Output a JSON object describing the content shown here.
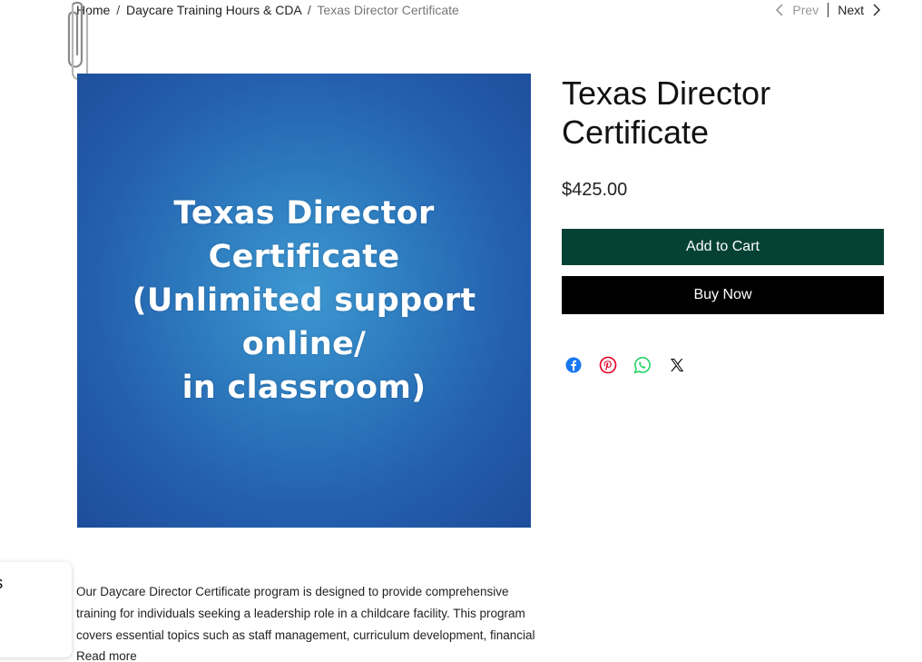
{
  "breadcrumb": {
    "home": "Home",
    "separator": "/",
    "category": "Daycare Training Hours & CDA",
    "current": "Texas Director Certificate"
  },
  "pager": {
    "prev_label": "Prev",
    "next_label": "Next"
  },
  "product": {
    "image_text": {
      "line1": "Texas Director",
      "line2": "Certificate",
      "line3": "(Unlimited support",
      "line4": "online/",
      "line5": "in classroom)"
    },
    "title": "Texas Director Certificate",
    "price": "$425.00",
    "add_to_cart_label": "Add to Cart",
    "buy_now_label": "Buy Now",
    "description": "Our Daycare Director Certificate program is designed to provide comprehensive training for individuals seeking a leadership role in a childcare facility. This program covers essential topics such as staff management, curriculum development, financial",
    "read_more_label": "Read more"
  },
  "social": {
    "icons": [
      "facebook-icon",
      "pinterest-icon",
      "whatsapp-icon",
      "x-icon"
    ]
  },
  "reviews_tab": {
    "label": "ws"
  },
  "colors": {
    "add_to_cart_bg": "#054235",
    "buy_now_bg": "#000000",
    "facebook": "#1877f2",
    "pinterest": "#e60023",
    "whatsapp": "#25d366",
    "x": "#000000",
    "image_bg": "#2a6fba"
  }
}
